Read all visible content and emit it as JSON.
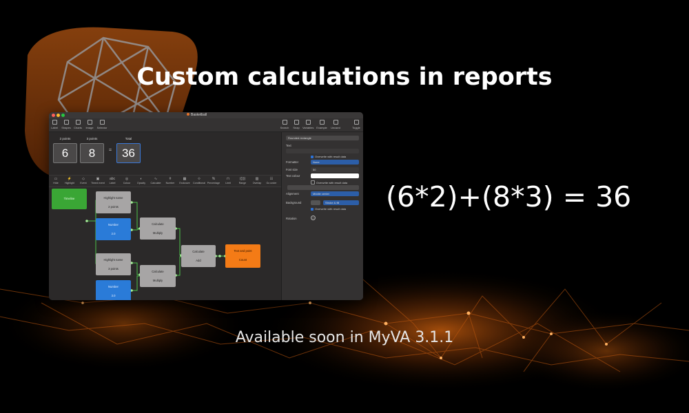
{
  "headline": "Custom calculations in reports",
  "equation": "(6*2)+(8*3) = 36",
  "footer": "Available soon in MyVA 3.1.1",
  "colors": {
    "accent_orange": "#f47b16",
    "brand_bg_orange": "#b0520c",
    "node_blue": "#2a7bd8",
    "node_green": "#3aa635",
    "node_grey": "#a7a5a5"
  },
  "window": {
    "title": "Basketball",
    "toolbar_left": [
      {
        "icon": "label-icon",
        "label": "Label"
      },
      {
        "icon": "shapes-icon",
        "label": "Shapes"
      },
      {
        "icon": "charts-icon",
        "label": "Charts"
      },
      {
        "icon": "image-icon",
        "label": "Image"
      },
      {
        "icon": "selector-icon",
        "label": "Selector"
      }
    ],
    "toolbar_right": [
      {
        "icon": "search-icon",
        "label": "Search"
      },
      {
        "icon": "snap-icon",
        "label": "Snap"
      },
      {
        "icon": "variables-icon",
        "label": "Variables"
      },
      {
        "icon": "example-icon",
        "label": "Example"
      },
      {
        "icon": "unused-icon",
        "label": "Unused"
      },
      {
        "icon": "toggle-icon",
        "label": "Toggle"
      }
    ],
    "calc": {
      "labels": [
        "2 points",
        "3 points",
        "Total"
      ],
      "values": [
        "6",
        "8",
        "36"
      ],
      "operator": "="
    },
    "palette": [
      {
        "icon": "▭",
        "label": "Hide"
      },
      {
        "icon": "⚡",
        "label": "Highlight"
      },
      {
        "icon": "◇",
        "label": "Event"
      },
      {
        "icon": "▣",
        "label": "Timed event"
      },
      {
        "icon": "abc",
        "label": "Label"
      },
      {
        "icon": "◎",
        "label": "Colour"
      },
      {
        "icon": "◐",
        "label": "Opacity"
      },
      {
        "icon": "∿",
        "label": "Calculate"
      },
      {
        "icon": "#",
        "label": "Number"
      },
      {
        "icon": "▦",
        "label": "Exclusive"
      },
      {
        "icon": "⟐",
        "label": "Conditional"
      },
      {
        "icon": "%",
        "label": "Percentage"
      },
      {
        "icon": "⊓",
        "label": "Limit"
      },
      {
        "icon": "(()))",
        "label": "Range"
      },
      {
        "icon": "▨",
        "label": "Overlap"
      },
      {
        "icon": "☷",
        "label": "Go under"
      }
    ],
    "nodes": {
      "timeline": "Timeline",
      "highlight1": [
        "Highlight name",
        "2 points"
      ],
      "number1": [
        "Number",
        "2.0"
      ],
      "calc1": [
        "Calculate",
        "Multiply"
      ],
      "highlight2": [
        "Highlight name",
        "3 points"
      ],
      "number2": [
        "Number",
        "3.0"
      ],
      "calc2": [
        "Calculate",
        "Multiply"
      ],
      "calc3": [
        "Calculate",
        "Add"
      ],
      "output": [
        "Text and point",
        "Count"
      ]
    },
    "sidebar": {
      "shape_value": "Rounded rectangle",
      "text_label": "Text",
      "overwrite_1": "Overwrite with result data",
      "formatter_label": "Formatter",
      "formatter_value": "None",
      "font_size_label": "Font size",
      "font_size_value": "50",
      "text_colour_label": "Text colour",
      "overwrite_2": "Overwrite with result data",
      "alignment_label": "Alignment",
      "alignment_value": "Middle center",
      "background_label": "Background",
      "background_value": "Stroke & fill",
      "overwrite_3": "Overwrite with result data",
      "rotation_label": "Rotation"
    }
  }
}
